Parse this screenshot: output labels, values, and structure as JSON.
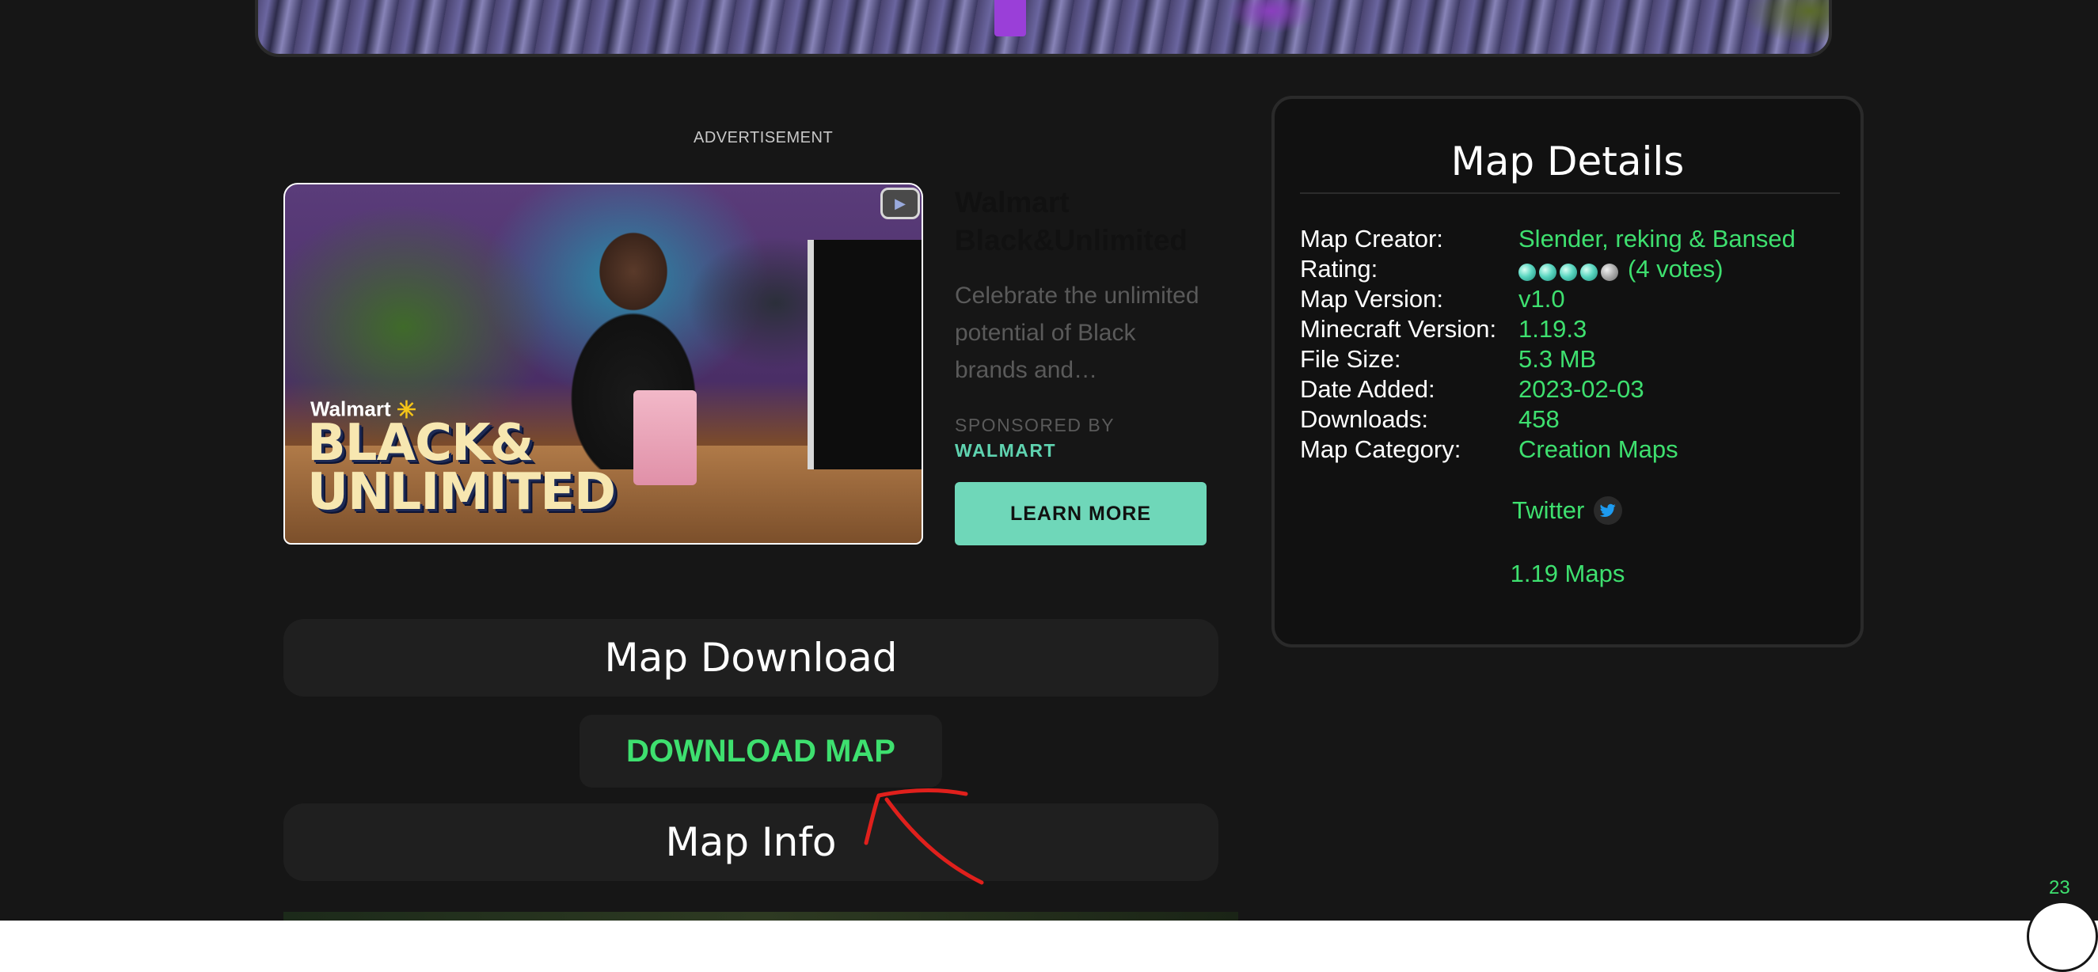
{
  "advertisement": {
    "label": "ADVERTISEMENT",
    "image_brand_small": "Walmart",
    "image_headline_line1": "BLACK&",
    "image_headline_line2": "UNLIMITED",
    "title": "Walmart Black&Unlimited",
    "description": "Celebrate the unlimited potential of Black brands and…",
    "sponsored_by_label": "SPONSORED BY",
    "sponsor_name": "WALMART",
    "cta_label": "LEARN MORE"
  },
  "sections": {
    "download_title": "Map Download",
    "download_button": "DOWNLOAD MAP",
    "info_title": "Map Info"
  },
  "map_details": {
    "title": "Map Details",
    "rows": [
      {
        "label": "Map Creator:",
        "value": "Slender, reking & Bansed"
      },
      {
        "label": "Rating:",
        "value": "(4 votes)",
        "rating_filled": 4,
        "rating_total": 5
      },
      {
        "label": "Map Version:",
        "value": "v1.0"
      },
      {
        "label": "Minecraft Version:",
        "value": "1.19.3"
      },
      {
        "label": "File Size:",
        "value": "5.3 MB"
      },
      {
        "label": "Date Added:",
        "value": "2023-02-03"
      },
      {
        "label": "Downloads:",
        "value": "458"
      },
      {
        "label": "Map Category:",
        "value": "Creation Maps"
      }
    ],
    "twitter_label": "Twitter",
    "version_maps_link": "1.19 Maps"
  },
  "page_number": "23",
  "colors": {
    "background": "#161616",
    "accent_green": "#3ee06f",
    "cta_teal": "#6fd7b9",
    "annotation_red": "#e0201c"
  },
  "icons": {
    "twitter": "twitter-bird-icon",
    "rating": "diamond-gem-icon",
    "ad_video": "video-play-icon"
  }
}
